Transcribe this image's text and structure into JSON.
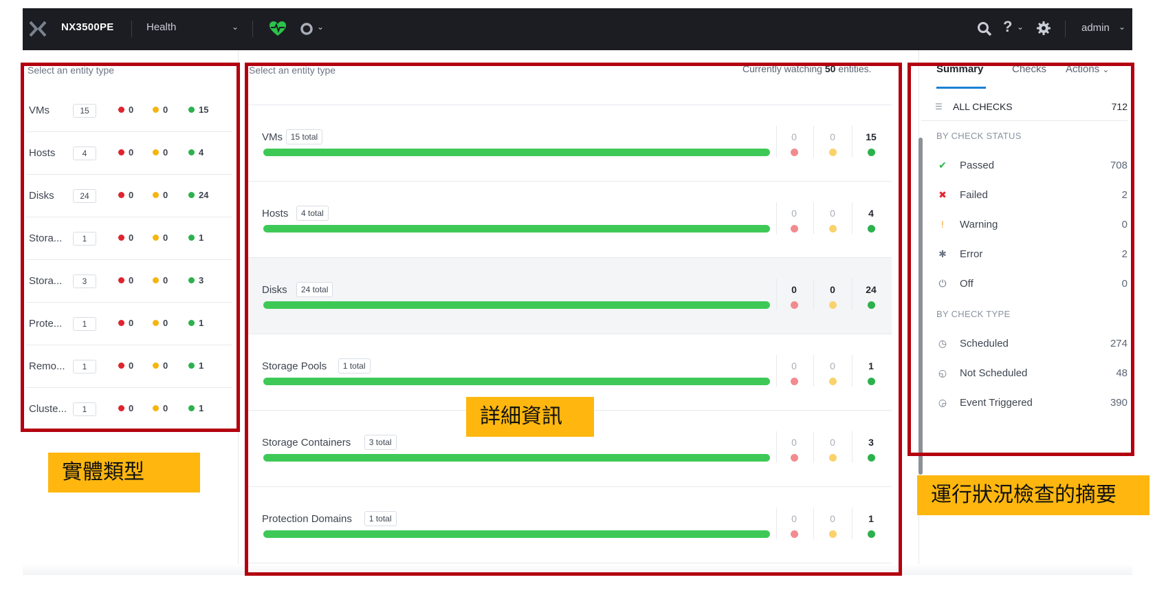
{
  "topbar": {
    "cluster_name": "NX3500PE",
    "menu_label": "Health",
    "user_label": "admin",
    "icons": [
      "nutanix-logo-icon",
      "health-heart-icon",
      "circle-status-icon",
      "search-icon",
      "help-icon",
      "gear-icon"
    ]
  },
  "left": {
    "select_label": "Select an entity type",
    "items": [
      {
        "name": "VMs",
        "count": "15",
        "critical": "0",
        "warning": "0",
        "good": "15"
      },
      {
        "name": "Hosts",
        "count": "4",
        "critical": "0",
        "warning": "0",
        "good": "4"
      },
      {
        "name": "Disks",
        "count": "24",
        "critical": "0",
        "warning": "0",
        "good": "24"
      },
      {
        "name": "Stora...",
        "count": "1",
        "critical": "0",
        "warning": "0",
        "good": "1"
      },
      {
        "name": "Stora...",
        "count": "3",
        "critical": "0",
        "warning": "0",
        "good": "3"
      },
      {
        "name": "Prote...",
        "count": "1",
        "critical": "0",
        "warning": "0",
        "good": "1"
      },
      {
        "name": "Remo...",
        "count": "1",
        "critical": "0",
        "warning": "0",
        "good": "1"
      },
      {
        "name": "Cluste...",
        "count": "1",
        "critical": "0",
        "warning": "0",
        "good": "1"
      }
    ]
  },
  "detail": {
    "select_label": "Select an entity type",
    "watching_prefix": "Currently watching ",
    "watching_count": "50",
    "watching_suffix": " entities.",
    "rows": [
      {
        "name": "VMs",
        "total": "15 total",
        "critical": "0",
        "warning": "0",
        "good": "15",
        "highlight": false,
        "good_fraction": 1.0
      },
      {
        "name": "Hosts",
        "total": "4 total",
        "critical": "0",
        "warning": "0",
        "good": "4",
        "highlight": false,
        "good_fraction": 1.0
      },
      {
        "name": "Disks",
        "total": "24 total",
        "critical": "0",
        "warning": "0",
        "good": "24",
        "highlight": true,
        "good_fraction": 1.0
      },
      {
        "name": "Storage Pools",
        "total": "1 total",
        "critical": "0",
        "warning": "0",
        "good": "1",
        "highlight": false,
        "good_fraction": 1.0
      },
      {
        "name": "Storage Containers",
        "total": "3 total",
        "critical": "0",
        "warning": "0",
        "good": "3",
        "highlight": false,
        "good_fraction": 1.0
      },
      {
        "name": "Protection Domains",
        "total": "1 total",
        "critical": "0",
        "warning": "0",
        "good": "1",
        "highlight": false,
        "good_fraction": 1.0
      }
    ]
  },
  "summary": {
    "tabs": {
      "summary": "Summary",
      "checks": "Checks",
      "actions": "Actions"
    },
    "all_checks": {
      "label": "ALL CHECKS",
      "value": "712"
    },
    "status_title": "BY CHECK STATUS",
    "status_items": [
      {
        "icon": "check-icon",
        "glyph": "✔",
        "color": "#2bb24c",
        "label": "Passed",
        "value": "708"
      },
      {
        "icon": "x-icon",
        "glyph": "✖",
        "color": "#e0242f",
        "label": "Failed",
        "value": "2"
      },
      {
        "icon": "exclamation-icon",
        "glyph": "!",
        "color": "#f5a623",
        "label": "Warning",
        "value": "0"
      },
      {
        "icon": "bug-icon",
        "glyph": "✱",
        "color": "#6b7585",
        "label": "Error",
        "value": "2"
      },
      {
        "icon": "power-icon",
        "glyph": "⏻",
        "color": "#6b7585",
        "label": "Off",
        "value": "0"
      }
    ],
    "type_title": "BY CHECK TYPE",
    "type_items": [
      {
        "icon": "clock-icon",
        "glyph": "◷",
        "color": "#6b7585",
        "label": "Scheduled",
        "value": "274"
      },
      {
        "icon": "clock-off-icon",
        "glyph": "◵",
        "color": "#6b7585",
        "label": "Not Scheduled",
        "value": "48"
      },
      {
        "icon": "event-clock-icon",
        "glyph": "◶",
        "color": "#6b7585",
        "label": "Event Triggered",
        "value": "390"
      }
    ]
  },
  "annotations": {
    "entity_type": "實體類型",
    "details": "詳細資訊",
    "summary": "運行狀況檢查的摘要"
  },
  "colors": {
    "critical": "#e0242f",
    "warning": "#f5b50f",
    "good": "#2bb24c",
    "critical_soft": "#f28b8f",
    "warning_soft": "#f9d26b",
    "bar": "#3ec957",
    "annotation_box": "#b3000f",
    "annotation_note": "#ffb70f"
  }
}
